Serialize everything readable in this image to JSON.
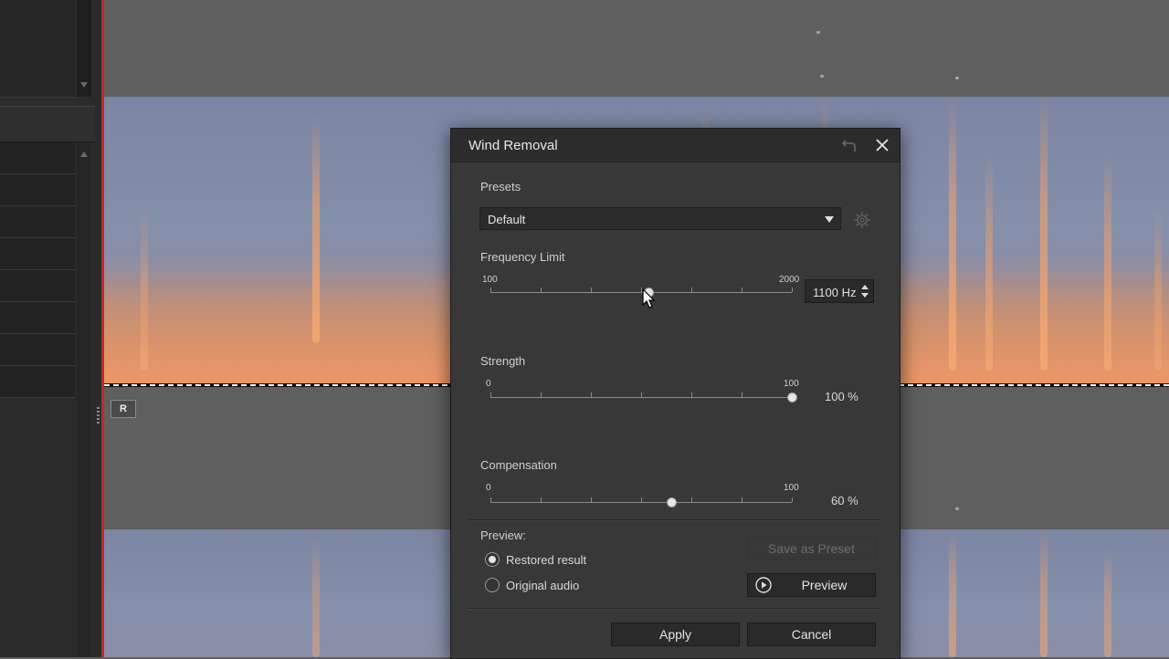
{
  "track": {
    "channel_badge": "R"
  },
  "dialog": {
    "title": "Wind Removal",
    "presets": {
      "label": "Presets",
      "selected": "Default"
    },
    "frequency_limit": {
      "label": "Frequency Limit",
      "min_label": "100",
      "max_label": "2000",
      "min": 100,
      "max": 2000,
      "value": 1100,
      "display": "1100 Hz"
    },
    "strength": {
      "label": "Strength",
      "min_label": "0",
      "max_label": "100",
      "min": 0,
      "max": 100,
      "value": 100,
      "display": "100 %"
    },
    "compensation": {
      "label": "Compensation",
      "min_label": "0",
      "max_label": "100",
      "min": 0,
      "max": 100,
      "value": 60,
      "display": "60 %"
    },
    "preview": {
      "label": "Preview:",
      "options": [
        {
          "label": "Restored result",
          "selected": true
        },
        {
          "label": "Original audio",
          "selected": false
        }
      ],
      "save_preset_label": "Save as Preset",
      "preview_button_label": "Preview"
    },
    "apply_label": "Apply",
    "cancel_label": "Cancel"
  },
  "icons": [
    "undo-icon",
    "close-icon",
    "gear-icon",
    "dropdown-caret-icon",
    "play-icon",
    "cursor-icon"
  ]
}
